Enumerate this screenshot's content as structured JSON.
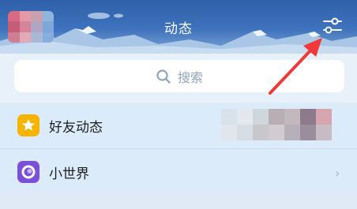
{
  "header": {
    "title": "动态",
    "settings_icon": "sliders-icon"
  },
  "search": {
    "placeholder": "搜索",
    "icon": "search-icon"
  },
  "list": {
    "items": [
      {
        "label": "好友动态",
        "icon": "star-badge-icon",
        "icon_color": "#f5b400"
      },
      {
        "label": "小世界",
        "icon": "ring-icon",
        "icon_color": "#7b4fd8"
      }
    ]
  },
  "annotation": {
    "color": "#f03a3a"
  }
}
